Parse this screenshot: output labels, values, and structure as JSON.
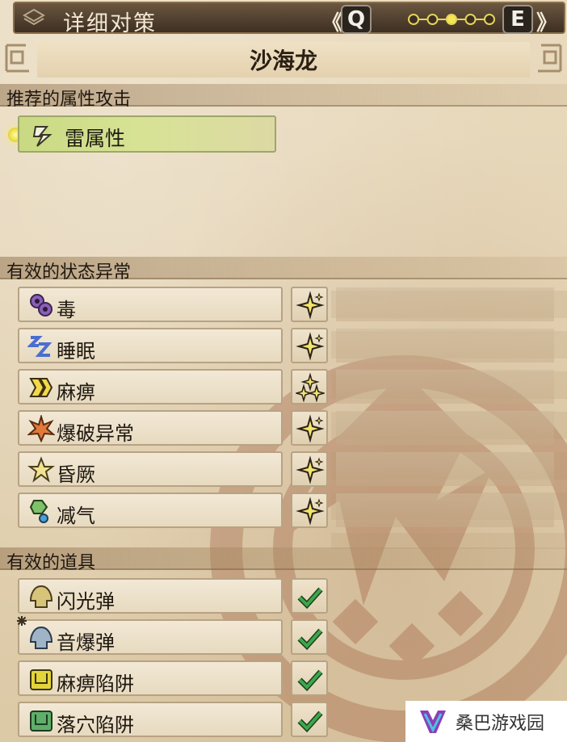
{
  "top_bar": {
    "title": "详细对策",
    "prev_key": "Q",
    "next_key": "E",
    "prev_chevron": "《",
    "next_chevron": "》",
    "page_total": 5,
    "page_current": 3
  },
  "monster": {
    "name": "沙海龙"
  },
  "sections": {
    "element": {
      "title": "推荐的属性攻击"
    },
    "status": {
      "title": "有效的状态异常"
    },
    "items": {
      "title": "有效的道具"
    }
  },
  "element_weakness": {
    "label": "雷属性",
    "icon": "thunder-icon"
  },
  "status_list": [
    {
      "label": "毒",
      "icon": "poison-icon",
      "rating": 1
    },
    {
      "label": "睡眠",
      "icon": "sleep-icon",
      "rating": 1
    },
    {
      "label": "麻痹",
      "icon": "paralysis-icon",
      "rating": 2
    },
    {
      "label": "爆破异常",
      "icon": "blast-icon",
      "rating": 1
    },
    {
      "label": "昏厥",
      "icon": "stun-icon",
      "rating": 1
    },
    {
      "label": "减气",
      "icon": "exhaust-icon",
      "rating": 1
    }
  ],
  "item_list": [
    {
      "label": "闪光弹",
      "icon": "flash-pod-icon",
      "effective": true
    },
    {
      "label": "音爆弹",
      "icon": "sonic-bomb-icon",
      "effective": true,
      "marked": true
    },
    {
      "label": "麻痹陷阱",
      "icon": "shock-trap-icon",
      "effective": true
    },
    {
      "label": "落穴陷阱",
      "icon": "pitfall-trap-icon",
      "effective": true
    }
  ],
  "colors": {
    "accent_yellow": "#f1e24a",
    "check_green": "#2f9a3a",
    "status_star": "#f3e46b"
  },
  "watermark": {
    "text": "桑巴游戏园"
  }
}
